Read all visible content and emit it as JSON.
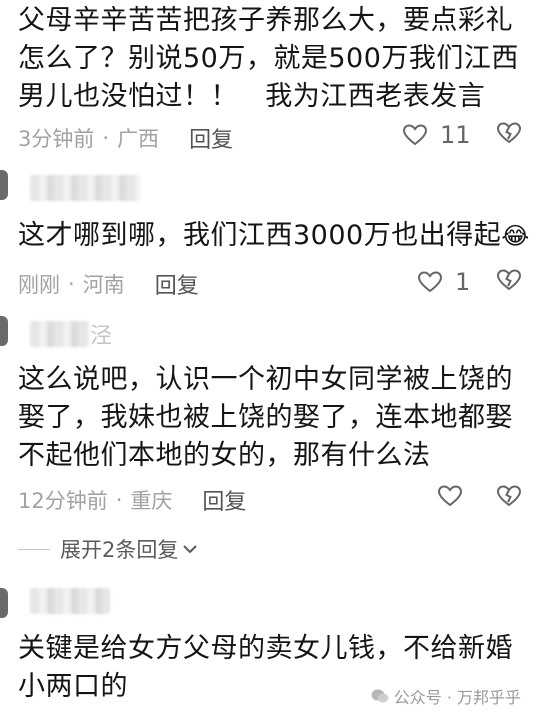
{
  "comments": [
    {
      "lines": [
        "父母辛辛苦苦把孩子养那么大，要点彩礼",
        "怎么了？别说50万，就是500万我们江西",
        "男儿也没怕过！！   我为江西老表发言"
      ],
      "time": "3分钟前",
      "location": "广西",
      "reply": "回复",
      "likes": "11"
    },
    {
      "lines": [
        "这才哪到哪，我们江西3000万也出得起"
      ],
      "emoji": "😂",
      "time": "刚刚",
      "location": "河南",
      "reply": "回复",
      "likes": "1"
    },
    {
      "username_partial": "泾",
      "lines": [
        "这么说吧，认识一个初中女同学被上饶的",
        "娶了，我妹也被上饶的娶了，连本地都娶",
        "不起他们本地的女的，那有什么法"
      ],
      "time": "12分钟前",
      "location": "重庆",
      "reply": "回复"
    },
    {
      "lines": [
        "关键是给女方父母的卖女儿钱，不给新婚",
        "小两口的"
      ]
    }
  ],
  "expand_replies": "展开2条回复",
  "separator": "·",
  "watermark": "公众号 · 万邦乎乎",
  "colors": {
    "meta": "#a2a2a2",
    "text": "#151515",
    "background": "#ffffff"
  }
}
